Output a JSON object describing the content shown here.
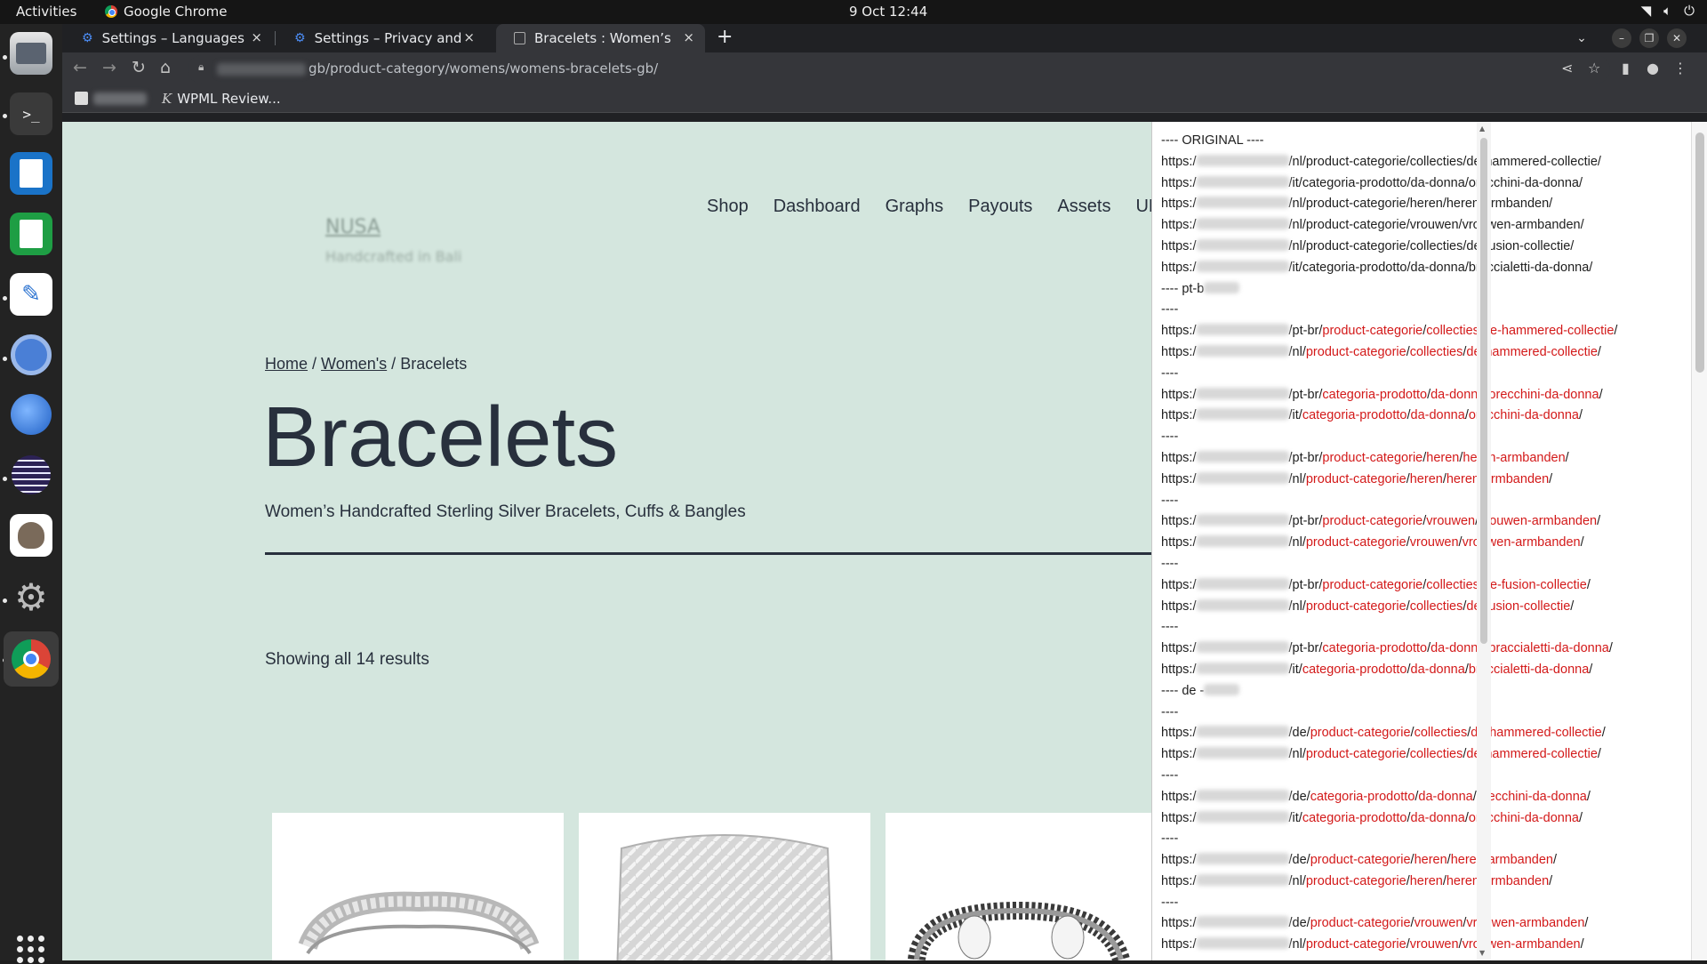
{
  "topbar": {
    "activities": "Activities",
    "app_name": "Google Chrome",
    "clock": "9 Oct  12:44"
  },
  "dock": {
    "items": [
      "files-icon",
      "terminal-icon",
      "writer-icon",
      "calc-icon",
      "text-editor-icon",
      "chromium-icon",
      "thunderbird-icon",
      "eclipse-icon",
      "gimp-icon",
      "settings-icon",
      "chrome-icon"
    ]
  },
  "tabs": [
    {
      "title": "Settings – Languages",
      "close": "×"
    },
    {
      "title": "Settings – Privacy and security",
      "close": "×"
    },
    {
      "title": "Bracelets : Women’s Handcrafted",
      "close": "×"
    }
  ],
  "toolbar": {
    "url": "gb/product-category/womens/womens-bracelets-gb/"
  },
  "bookmarks": {
    "item2": "WPML Review..."
  },
  "site": {
    "logo_name": "NUSA",
    "logo_tag": "Handcrafted in Bali",
    "menu": [
      "Shop",
      "Dashboard",
      "Graphs",
      "Payouts",
      "Assets",
      "URL"
    ],
    "breadcrumb": {
      "home": "Home",
      "sep": " / ",
      "womens": "Women's",
      "current": "Bracelets"
    },
    "title": "Bracelets",
    "subtitle": "Women’s Handcrafted Sterling Silver Bracelets, Cuffs & Bangles",
    "results": "Showing all 14 results"
  },
  "panel": {
    "lines": [
      {
        "type": "plain",
        "text": "---- ORIGINAL ----"
      },
      {
        "type": "url",
        "lang": "nl",
        "parts": [
          "product-categorie",
          "collecties",
          "de-hammered-collectie"
        ],
        "red": false
      },
      {
        "type": "url",
        "lang": "it",
        "parts": [
          "categoria-prodotto",
          "da-donna",
          "orecchini-da-donna"
        ],
        "red": false
      },
      {
        "type": "url",
        "lang": "nl",
        "parts": [
          "product-categorie",
          "heren",
          "heren-armbanden"
        ],
        "red": false
      },
      {
        "type": "url",
        "lang": "nl",
        "parts": [
          "product-categorie",
          "vrouwen",
          "vrouwen-armbanden"
        ],
        "red": false
      },
      {
        "type": "url",
        "lang": "nl",
        "parts": [
          "product-categorie",
          "collecties",
          "de-fusion-collectie"
        ],
        "red": false
      },
      {
        "type": "url",
        "lang": "it",
        "parts": [
          "categoria-prodotto",
          "da-donna",
          "braccialetti-da-donna"
        ],
        "red": false
      },
      {
        "type": "heading",
        "text": "---- pt-b"
      },
      {
        "type": "plain",
        "text": "----"
      },
      {
        "type": "url",
        "lang": "pt-br",
        "parts": [
          "product-categorie",
          "collecties",
          "de-hammered-collectie"
        ],
        "red": true
      },
      {
        "type": "url",
        "lang": "nl",
        "parts": [
          "product-categorie",
          "collecties",
          "de-hammered-collectie"
        ],
        "red": true
      },
      {
        "type": "plain",
        "text": "----"
      },
      {
        "type": "url",
        "lang": "pt-br",
        "parts": [
          "categoria-prodotto",
          "da-donna",
          "orecchini-da-donna"
        ],
        "red": true
      },
      {
        "type": "url",
        "lang": "it",
        "parts": [
          "categoria-prodotto",
          "da-donna",
          "orecchini-da-donna"
        ],
        "red": true
      },
      {
        "type": "plain",
        "text": "----"
      },
      {
        "type": "url",
        "lang": "pt-br",
        "parts": [
          "product-categorie",
          "heren",
          "heren-armbanden"
        ],
        "red": true
      },
      {
        "type": "url",
        "lang": "nl",
        "parts": [
          "product-categorie",
          "heren",
          "heren-armbanden"
        ],
        "red": true
      },
      {
        "type": "plain",
        "text": "----"
      },
      {
        "type": "url",
        "lang": "pt-br",
        "parts": [
          "product-categorie",
          "vrouwen",
          "vrouwen-armbanden"
        ],
        "red": true
      },
      {
        "type": "url",
        "lang": "nl",
        "parts": [
          "product-categorie",
          "vrouwen",
          "vrouwen-armbanden"
        ],
        "red": true
      },
      {
        "type": "plain",
        "text": "----"
      },
      {
        "type": "url",
        "lang": "pt-br",
        "parts": [
          "product-categorie",
          "collecties",
          "de-fusion-collectie"
        ],
        "red": true
      },
      {
        "type": "url",
        "lang": "nl",
        "parts": [
          "product-categorie",
          "collecties",
          "de-fusion-collectie"
        ],
        "red": true
      },
      {
        "type": "plain",
        "text": "----"
      },
      {
        "type": "url",
        "lang": "pt-br",
        "parts": [
          "categoria-prodotto",
          "da-donna",
          "braccialetti-da-donna"
        ],
        "red": true
      },
      {
        "type": "url",
        "lang": "it",
        "parts": [
          "categoria-prodotto",
          "da-donna",
          "braccialetti-da-donna"
        ],
        "red": true
      },
      {
        "type": "heading",
        "text": "---- de -"
      },
      {
        "type": "plain",
        "text": "----"
      },
      {
        "type": "url",
        "lang": "de",
        "parts": [
          "product-categorie",
          "collecties",
          "de-hammered-collectie"
        ],
        "red": true
      },
      {
        "type": "url",
        "lang": "nl",
        "parts": [
          "product-categorie",
          "collecties",
          "de-hammered-collectie"
        ],
        "red": true
      },
      {
        "type": "plain",
        "text": "----"
      },
      {
        "type": "url",
        "lang": "de",
        "parts": [
          "categoria-prodotto",
          "da-donna",
          "orecchini-da-donna"
        ],
        "red": true
      },
      {
        "type": "url",
        "lang": "it",
        "parts": [
          "categoria-prodotto",
          "da-donna",
          "orecchini-da-donna"
        ],
        "red": true
      },
      {
        "type": "plain",
        "text": "----"
      },
      {
        "type": "url",
        "lang": "de",
        "parts": [
          "product-categorie",
          "heren",
          "heren-armbanden"
        ],
        "red": true
      },
      {
        "type": "url",
        "lang": "nl",
        "parts": [
          "product-categorie",
          "heren",
          "heren-armbanden"
        ],
        "red": true
      },
      {
        "type": "plain",
        "text": "----"
      },
      {
        "type": "url",
        "lang": "de",
        "parts": [
          "product-categorie",
          "vrouwen",
          "vrouwen-armbanden"
        ],
        "red": true
      },
      {
        "type": "url",
        "lang": "nl",
        "parts": [
          "product-categorie",
          "vrouwen",
          "vrouwen-armbanden"
        ],
        "red": true
      }
    ],
    "url_prefix": "https:/"
  },
  "colors": {
    "page_bg": "#d4e6de",
    "text_dark": "#28303d",
    "highlight_red": "#d31919"
  }
}
